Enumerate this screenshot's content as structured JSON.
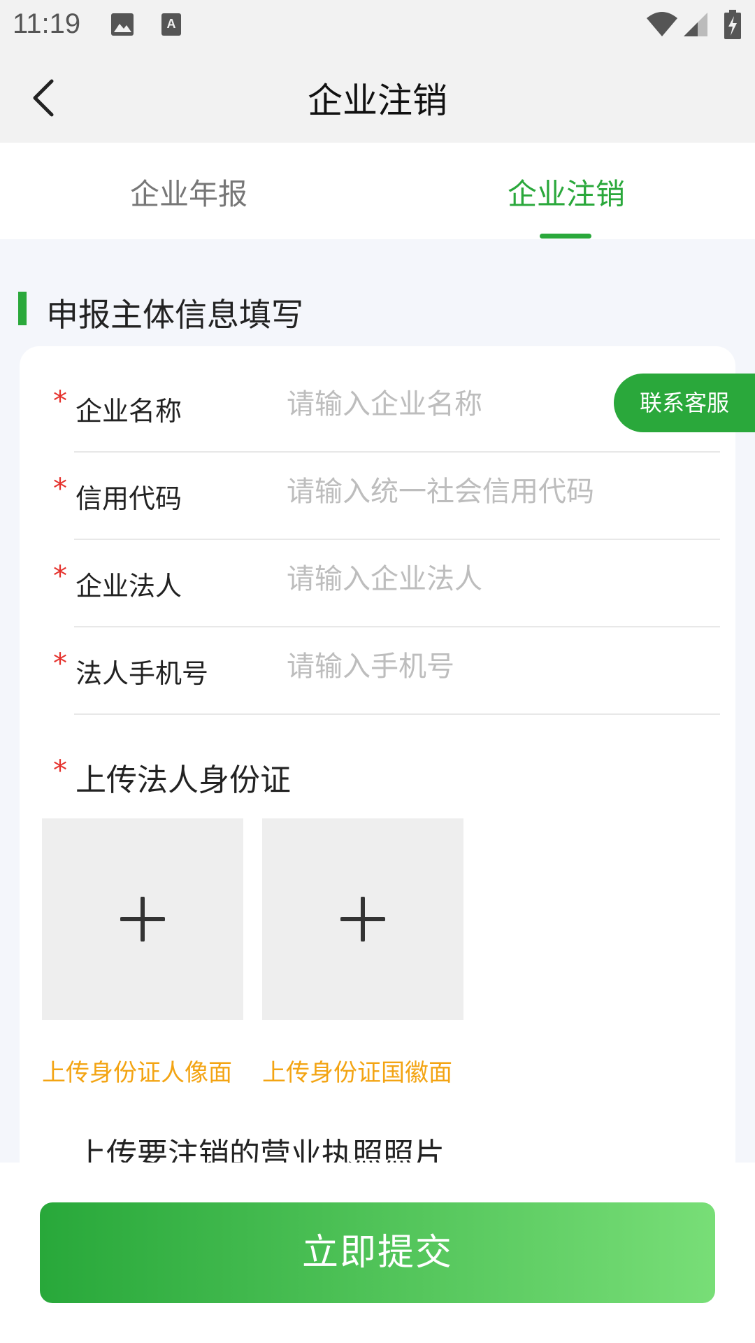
{
  "status_bar": {
    "time": "11:19",
    "icons": [
      "image-icon",
      "keyboard-a-icon",
      "wifi-icon",
      "signal-icon",
      "battery-charging-icon"
    ]
  },
  "nav": {
    "title": "企业注销",
    "back_icon": "chevron-left-icon"
  },
  "tabs": [
    {
      "label": "企业年报",
      "active": false
    },
    {
      "label": "企业注销",
      "active": true
    }
  ],
  "section": {
    "title": "申报主体信息填写"
  },
  "form": {
    "fields": [
      {
        "label": "企业名称",
        "placeholder": "请输入企业名称",
        "value": "",
        "required": "*"
      },
      {
        "label": "信用代码",
        "placeholder": "请输入统一社会信用代码",
        "value": "",
        "required": "*"
      },
      {
        "label": "企业法人",
        "placeholder": "请输入企业法人",
        "value": "",
        "required": "*"
      },
      {
        "label": "法人手机号",
        "placeholder": "请输入手机号",
        "value": "",
        "required": "*"
      }
    ],
    "id_upload": {
      "required": "*",
      "label": "上传法人身份证",
      "front_caption": "上传身份证人像面",
      "back_caption": "上传身份证国徽面",
      "icon": "plus-icon"
    },
    "license_upload_label": "上传要注销的营业执照照片"
  },
  "contact_button": "联系客服",
  "submit_button": "立即提交",
  "colors": {
    "accent": "#2aa83b",
    "required": "#e5322d",
    "caption": "#f3a413",
    "placeholder": "#bdbdbd",
    "page_bg": "#f4f6fb"
  }
}
